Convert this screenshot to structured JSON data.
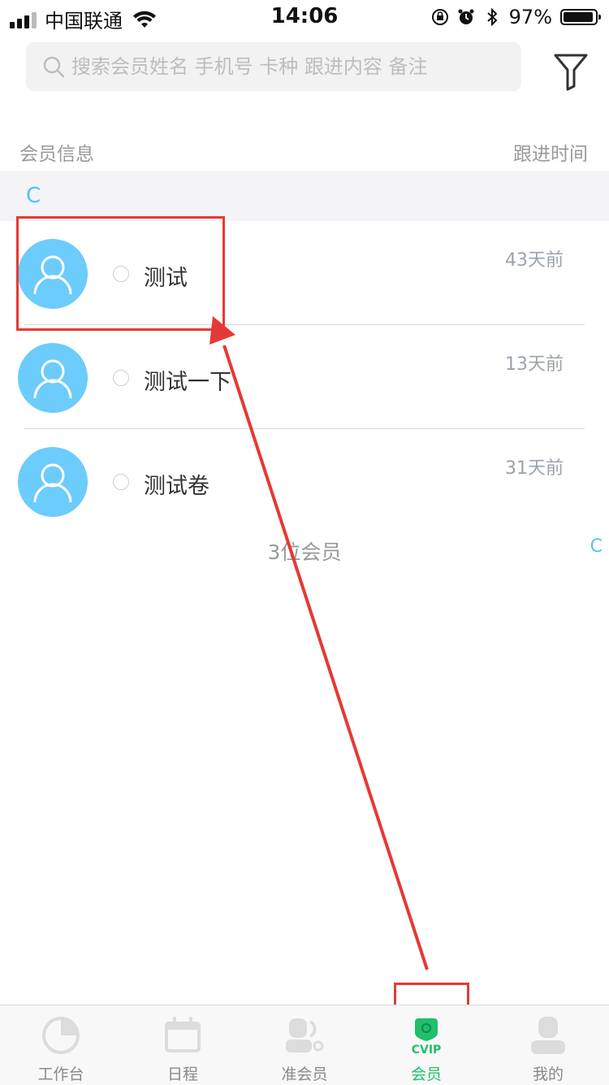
{
  "status_bar": {
    "carrier": "中国联通",
    "time": "14:06",
    "battery": "97%"
  },
  "search": {
    "placeholder": "搜索会员姓名 手机号 卡种 跟进内容 备注",
    "value": ""
  },
  "list_header": {
    "left": "会员信息",
    "right": "跟进时间"
  },
  "section": {
    "letter": "C"
  },
  "members": [
    {
      "name": "测试",
      "time": "43天前"
    },
    {
      "name": "测试一下",
      "time": "13天前"
    },
    {
      "name": "测试卷",
      "time": "31天前"
    }
  ],
  "member_count": "3位会员",
  "index_bar": {
    "letters": [
      "C"
    ]
  },
  "tabbar": {
    "items": [
      {
        "label": "工作台",
        "icon": "pie-chart-icon",
        "active": false
      },
      {
        "label": "日程",
        "icon": "calendar-icon",
        "active": false
      },
      {
        "label": "准会员",
        "icon": "prospect-members-icon",
        "active": false
      },
      {
        "label": "会员",
        "icon": "vip-icon",
        "active": true
      },
      {
        "label": "我的",
        "icon": "profile-icon",
        "active": false
      }
    ]
  },
  "colors": {
    "accent": "#4fc3f7",
    "avatar": "#6cccfb",
    "active_tab": "#1fbf6b",
    "annotation": "#e53935"
  }
}
